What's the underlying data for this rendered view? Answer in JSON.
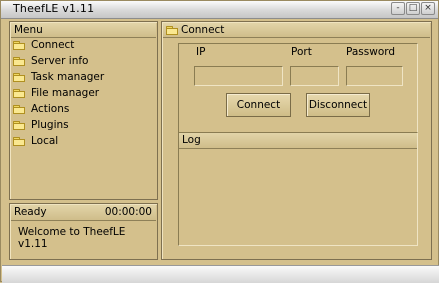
{
  "window": {
    "title": "TheefLE v1.11"
  },
  "titlebar_buttons": {
    "minimize": "-",
    "maximize": "□",
    "close": "×"
  },
  "menu": {
    "title": "Menu",
    "items": [
      {
        "label": "Connect",
        "icon": "folder-icon"
      },
      {
        "label": "Server info",
        "icon": "folder-icon"
      },
      {
        "label": "Task manager",
        "icon": "folder-icon"
      },
      {
        "label": "File manager",
        "icon": "folder-icon"
      },
      {
        "label": "Actions",
        "icon": "folder-icon"
      },
      {
        "label": "Plugins",
        "icon": "folder-icon"
      },
      {
        "label": "Local",
        "icon": "folder-icon"
      }
    ]
  },
  "status": {
    "state": "Ready",
    "time": "00:00:00",
    "message": "Welcome to TheefLE v1.11"
  },
  "connect_panel": {
    "title": "Connect",
    "fields": {
      "ip_label": "IP",
      "port_label": "Port",
      "password_label": "Password",
      "ip_value": "",
      "port_value": "",
      "password_value": ""
    },
    "connect_button": "Connect",
    "disconnect_button": "Disconnect"
  },
  "log": {
    "title": "Log",
    "content": ""
  },
  "colors": {
    "panel_bg": "#d4c08c",
    "border": "#7e7050",
    "titlebar": "#d8d8d8"
  }
}
